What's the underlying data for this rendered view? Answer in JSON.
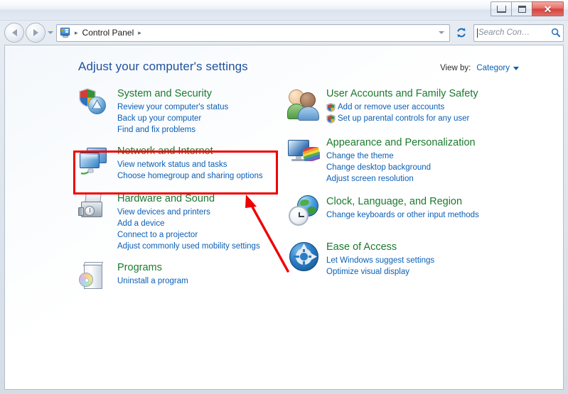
{
  "window": {
    "titlebar_buttons": [
      {
        "name": "minimize",
        "glyph": "minimize-icon"
      },
      {
        "name": "maximize",
        "glyph": "maximize-icon"
      },
      {
        "name": "close",
        "glyph": "close-icon",
        "label": "✕"
      }
    ]
  },
  "navbar": {
    "back_label": "Back",
    "forward_label": "Forward",
    "history_label": "Recent pages",
    "breadcrumbs": [
      "Control Panel"
    ],
    "separator": "▸",
    "refresh_label": "Refresh",
    "search": {
      "value": "",
      "placeholder": "Search Con…"
    }
  },
  "page": {
    "title": "Adjust your computer's settings",
    "view_by_label": "View by:",
    "view_by_value": "Category"
  },
  "categories": {
    "left": [
      {
        "icon": "security-shield-icon",
        "title": "System and Security",
        "links": [
          {
            "text": "Review your computer's status",
            "shield": false
          },
          {
            "text": "Back up your computer",
            "shield": false
          },
          {
            "text": "Find and fix problems",
            "shield": false
          }
        ]
      },
      {
        "icon": "network-monitors-icon",
        "title": "Network and Internet",
        "links": [
          {
            "text": "View network status and tasks",
            "shield": false
          },
          {
            "text": "Choose homegroup and sharing options",
            "shield": false
          }
        ]
      },
      {
        "icon": "printer-speaker-icon",
        "title": "Hardware and Sound",
        "links": [
          {
            "text": "View devices and printers",
            "shield": false
          },
          {
            "text": "Add a device",
            "shield": false
          },
          {
            "text": "Connect to a projector",
            "shield": false
          },
          {
            "text": "Adjust commonly used mobility settings",
            "shield": false
          }
        ]
      },
      {
        "icon": "programs-box-cd-icon",
        "title": "Programs",
        "links": [
          {
            "text": "Uninstall a program",
            "shield": false
          }
        ]
      }
    ],
    "right": [
      {
        "icon": "users-people-icon",
        "title": "User Accounts and Family Safety",
        "links": [
          {
            "text": "Add or remove user accounts",
            "shield": true
          },
          {
            "text": "Set up parental controls for any user",
            "shield": true
          }
        ]
      },
      {
        "icon": "monitor-color-fan-icon",
        "title": "Appearance and Personalization",
        "links": [
          {
            "text": "Change the theme",
            "shield": false
          },
          {
            "text": "Change desktop background",
            "shield": false
          },
          {
            "text": "Adjust screen resolution",
            "shield": false
          }
        ]
      },
      {
        "icon": "globe-clock-icon",
        "title": "Clock, Language, and Region",
        "links": [
          {
            "text": "Change keyboards or other input methods",
            "shield": false
          }
        ]
      },
      {
        "icon": "ease-of-access-icon",
        "title": "Ease of Access",
        "links": [
          {
            "text": "Let Windows suggest settings",
            "shield": false
          },
          {
            "text": "Optimize visual display",
            "shield": false
          }
        ]
      }
    ]
  },
  "annotations": {
    "highlight_color": "#ee0000",
    "box_target": "Network and Internet",
    "arrow_target": "Network and Internet"
  },
  "colors": {
    "category_title": "#1b7a2e",
    "link": "#0b5fb5",
    "page_title": "#20519e",
    "annotation": "#ee0000"
  }
}
